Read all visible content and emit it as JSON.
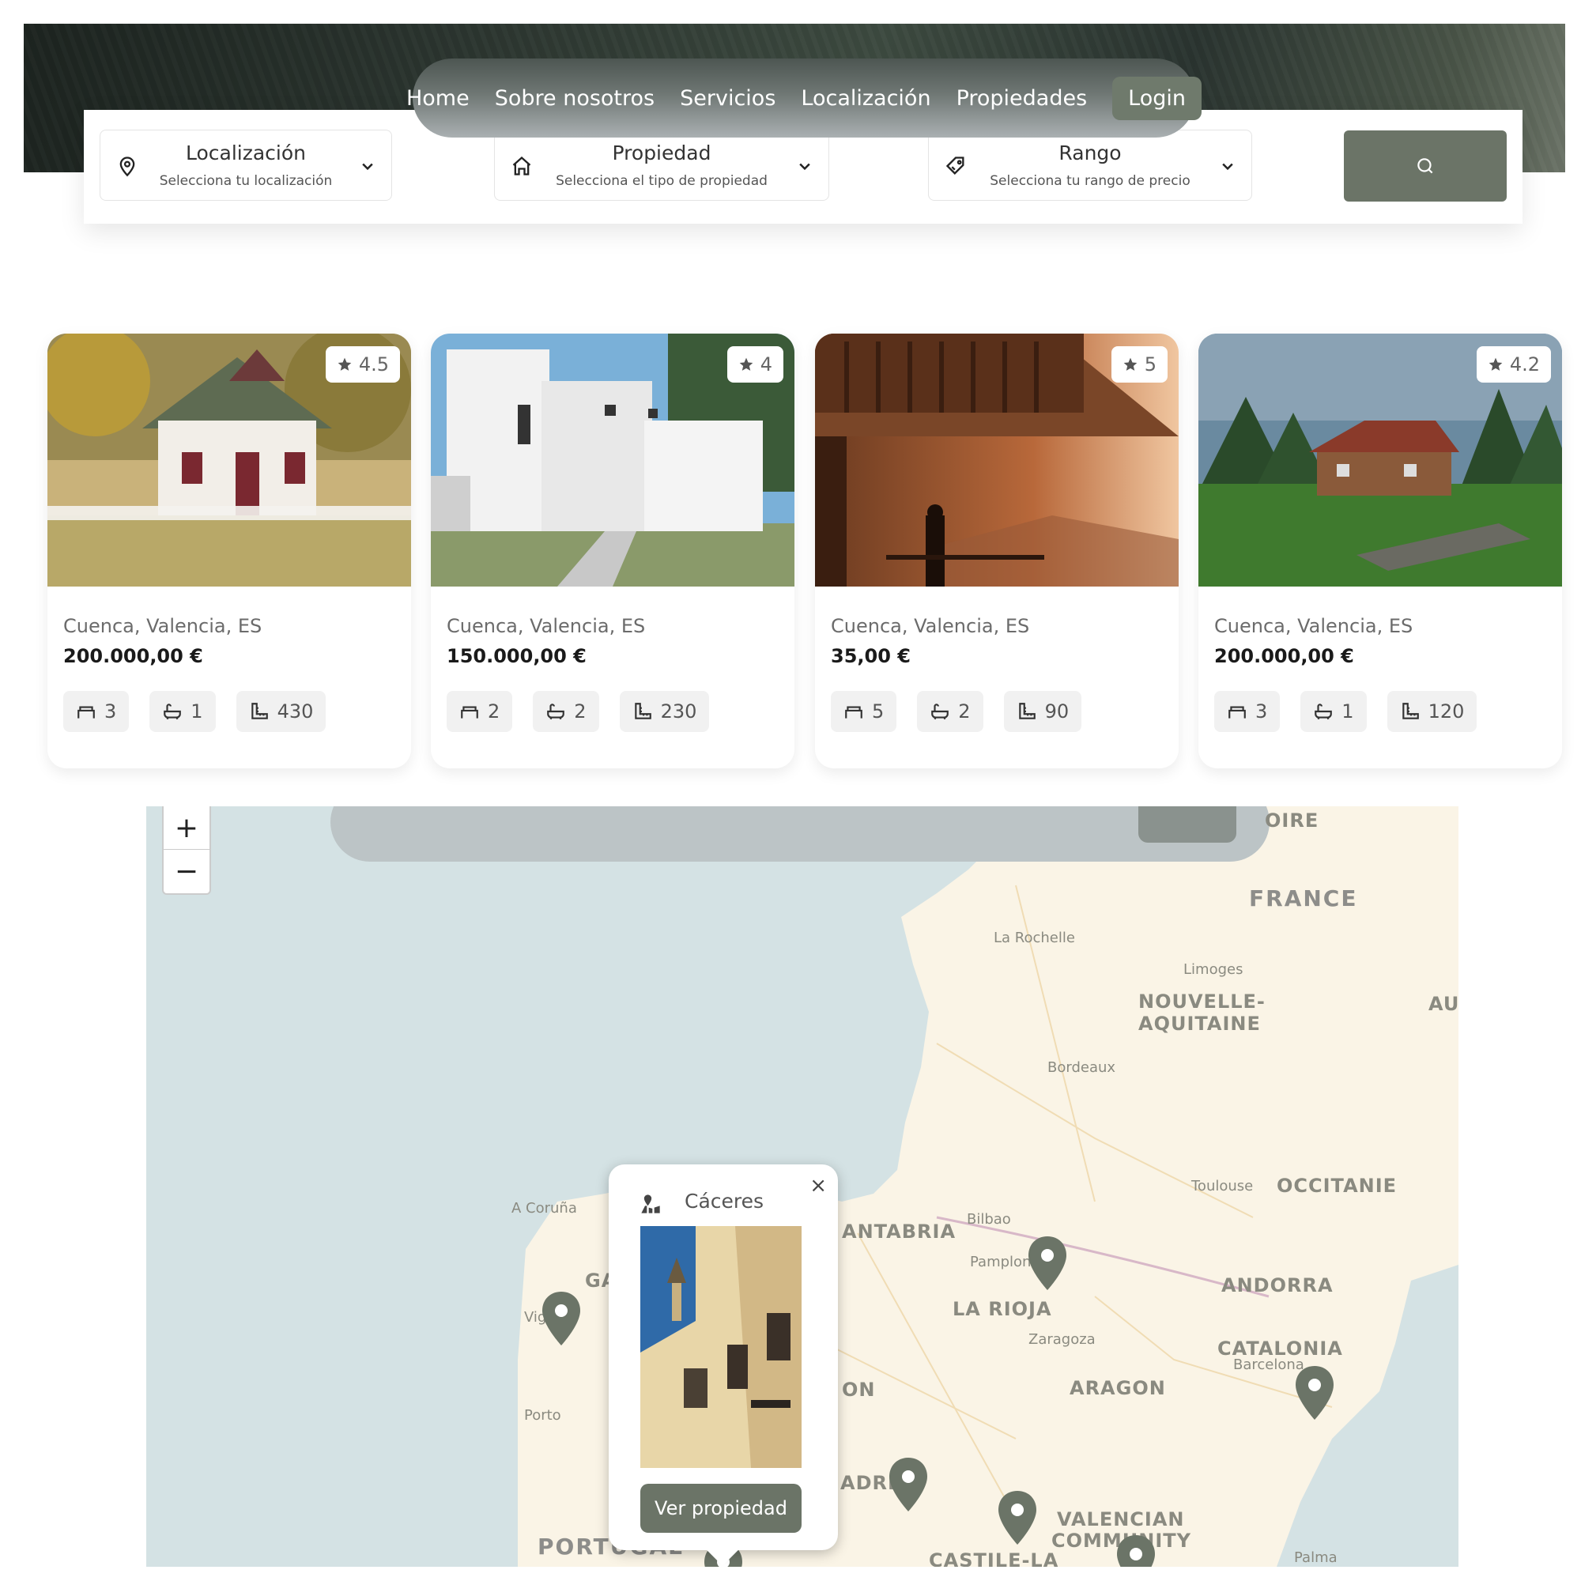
{
  "nav": {
    "links": [
      "Home",
      "Sobre nosotros",
      "Servicios",
      "Localización",
      "Propiedades"
    ],
    "login": "Login"
  },
  "search": {
    "location": {
      "title": "Localización",
      "subtitle": "Selecciona tu localización",
      "icon": "map-pin-icon"
    },
    "property": {
      "title": "Propiedad",
      "subtitle": "Selecciona el tipo de propiedad",
      "icon": "house-icon"
    },
    "range": {
      "title": "Rango",
      "subtitle": "Selecciona tu rango de precio",
      "icon": "price-tag-icon"
    },
    "button_icon": "search-icon"
  },
  "cards": [
    {
      "rating": "4.5",
      "location": "Cuenca, Valencia, ES",
      "price": "200.000,00 €",
      "beds": "3",
      "baths": "1",
      "area": "430"
    },
    {
      "rating": "4",
      "location": "Cuenca, Valencia, ES",
      "price": "150.000,00 €",
      "beds": "2",
      "baths": "2",
      "area": "230"
    },
    {
      "rating": "5",
      "location": "Cuenca, Valencia, ES",
      "price": "35,00 €",
      "beds": "5",
      "baths": "2",
      "area": "90"
    },
    {
      "rating": "4.2",
      "location": "Cuenca, Valencia, ES",
      "price": "200.000,00 €",
      "beds": "3",
      "baths": "1",
      "area": "120"
    }
  ],
  "map": {
    "zoom_in": "+",
    "zoom_out": "−",
    "countries": [
      "FRANCE",
      "PORTUGAL",
      "ANDORRA"
    ],
    "regions": [
      "NOUVELLE-",
      "AQUITAINE",
      "OCCITANIE",
      "CATALONIA",
      "ARAGON",
      "LA RIOJA",
      "ANTABRIA",
      "VALENCIAN",
      "COMMUNITY",
      "CASTILE-LA",
      "OIRE",
      "AU",
      "GA",
      "ON",
      "ADRI"
    ],
    "cities": [
      "La Rochelle",
      "Limoges",
      "Bordeaux",
      "Toulouse",
      "Bilbao",
      "Pamplona",
      "Zaragoza",
      "Barcelona",
      "A Coruña",
      "Vigo",
      "Porto",
      "Palma"
    ],
    "popup": {
      "title": "Cáceres",
      "button": "Ver propiedad",
      "close": "×",
      "icon": "map-location-icon"
    }
  },
  "colors": {
    "accent": "#6b7467",
    "map_water": "#d4e2e4",
    "map_land": "#faf4e6"
  }
}
